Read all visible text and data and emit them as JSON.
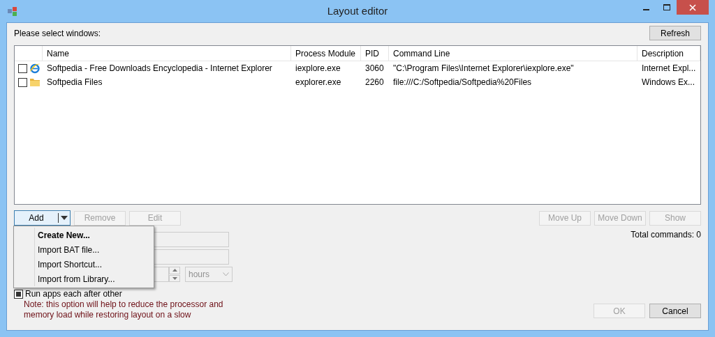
{
  "window": {
    "title": "Layout editor"
  },
  "prompt": "Please select windows:",
  "refresh_button": {
    "label": "Refresh",
    "disabled": false
  },
  "table": {
    "columns": [
      "Name",
      "Process Module",
      "PID",
      "Command Line",
      "Description"
    ],
    "rows": [
      {
        "checked": false,
        "kind": "browser",
        "cells": [
          "Softpedia - Free Downloads Encyclopedia - Internet Explorer",
          "iexplore.exe",
          "3060",
          "\"C:\\Program Files\\Internet Explorer\\iexplore.exe\"",
          "Internet Expl..."
        ]
      },
      {
        "checked": false,
        "kind": "folder",
        "cells": [
          "Softpedia Files",
          "explorer.exe",
          "2260",
          "file:///C:/Softpedia/Softpedia%20Files",
          "Windows Ex..."
        ]
      }
    ]
  },
  "add_button": {
    "label": "Add",
    "disabled": false
  },
  "left_buttons": [
    {
      "label": "Remove",
      "disabled": true
    },
    {
      "label": "Edit",
      "disabled": true
    }
  ],
  "right_buttons": [
    {
      "label": "Move Up",
      "disabled": true
    },
    {
      "label": "Move Down",
      "disabled": true
    },
    {
      "label": "Show",
      "disabled": true
    }
  ],
  "total_commands": "Total commands: 0",
  "unit_dropdown": {
    "value": "hours",
    "disabled": true
  },
  "run_sequential": {
    "label": "Run apps each after other",
    "checked": true
  },
  "note": [
    "Note: this option will help to reduce the processor and",
    "memory load while restoring layout on a slow"
  ],
  "add_menu": [
    {
      "label": "Create New...",
      "default": true
    },
    {
      "label": "Import BAT file...",
      "default": false
    },
    {
      "label": "Import Shortcut...",
      "default": false
    },
    {
      "label": "Import from Library...",
      "default": false
    }
  ],
  "dialog_buttons": [
    {
      "label": "OK",
      "disabled": true
    },
    {
      "label": "Cancel",
      "disabled": false
    }
  ]
}
